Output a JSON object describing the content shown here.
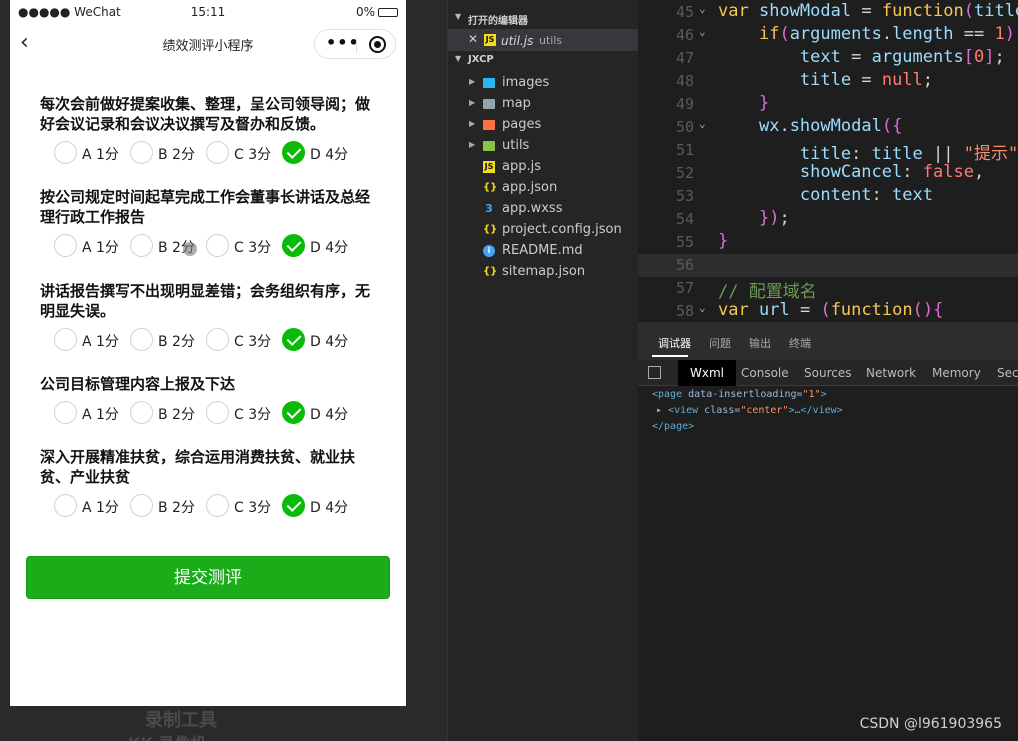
{
  "simulator": {
    "status": {
      "carrier": "●●●●● WeChat",
      "time": "15:11",
      "battery": "0%"
    },
    "nav": {
      "back": "‹",
      "title": "绩效测评小程序",
      "more": "•••"
    },
    "questions": [
      {
        "text": "每次会前做好提案收集、整理，呈公司领导阅；做好会议记录和会议决议撰写及督办和反馈。",
        "options": [
          "A 1分",
          "B 2分",
          "C 3分",
          "D 4分"
        ],
        "selected": 3
      },
      {
        "text": "按公司规定时间起草完成工作会董事长讲话及总经理行政工作报告",
        "options": [
          "A 1分",
          "B 2分",
          "C 3分",
          "D 4分"
        ],
        "selected": 3
      },
      {
        "text": "讲话报告撰写不出现明显差错；会务组织有序，无明显失误。",
        "options": [
          "A 1分",
          "B 2分",
          "C 3分",
          "D 4分"
        ],
        "selected": 3
      },
      {
        "text": "公司目标管理内容上报及下达",
        "options": [
          "A 1分",
          "B 2分",
          "C 3分",
          "D 4分"
        ],
        "selected": 3
      },
      {
        "text": "深入开展精准扶贫，综合运用消费扶贫、就业扶贫、产业扶贫",
        "options": [
          "A 1分",
          "B 2分",
          "C 3分",
          "D 4分"
        ],
        "selected": 3
      }
    ],
    "submit": "提交测评",
    "watermark1": "录制工具",
    "watermark2": "KK 录像机"
  },
  "explorer": {
    "open_editors": "打开的编辑器",
    "open_file": {
      "name": "util.js",
      "dir": "utils"
    },
    "project": "JXCP",
    "items": [
      {
        "name": "images",
        "type": "folder",
        "color": "#29b6f6"
      },
      {
        "name": "map",
        "type": "folder",
        "color": "#90a4ae"
      },
      {
        "name": "pages",
        "type": "folder",
        "color": "#ff7043"
      },
      {
        "name": "utils",
        "type": "folder",
        "color": "#8bc34a"
      },
      {
        "name": "app.js",
        "type": "js",
        "color": "#f5de19"
      },
      {
        "name": "app.json",
        "type": "json",
        "color": "#f5de19"
      },
      {
        "name": "app.wxss",
        "type": "css",
        "color": "#42a5f5"
      },
      {
        "name": "project.config.json",
        "type": "json",
        "color": "#f5de19"
      },
      {
        "name": "README.md",
        "type": "info",
        "color": "#42a5f5"
      },
      {
        "name": "sitemap.json",
        "type": "json",
        "color": "#f5de19"
      }
    ]
  },
  "editor": {
    "line_numbers": [
      "45",
      "46",
      "47",
      "48",
      "49",
      "50",
      "51",
      "52",
      "53",
      "54",
      "55",
      "56",
      "57",
      "58"
    ],
    "lines": [
      "var showModal = function(title",
      "    if(arguments.length == 1)",
      "        text = arguments[0];",
      "        title = null;",
      "    }",
      "    wx.showModal({",
      "        title: title || \"提示\"",
      "        showCancel: false,",
      "        content: text",
      "    });",
      "}",
      "",
      "// 配置域名",
      "var url = (function(){"
    ]
  },
  "debugger": {
    "tabs": [
      "调试器",
      "问题",
      "输出",
      "终端"
    ],
    "subtabs": [
      "Wxml",
      "Console",
      "Sources",
      "Network",
      "Memory",
      "Secu"
    ],
    "xml": {
      "line1_tag": "<page",
      "line1_attr": " data-insertloading=",
      "line1_val": "\"1\"",
      "line1_end": ">",
      "line2_tag": "<view",
      "line2_attr": " class=",
      "line2_val": "\"center\"",
      "line2_end": ">…</view>",
      "line3": "</page>"
    }
  },
  "watermark_csdn": "CSDN @l961903965"
}
